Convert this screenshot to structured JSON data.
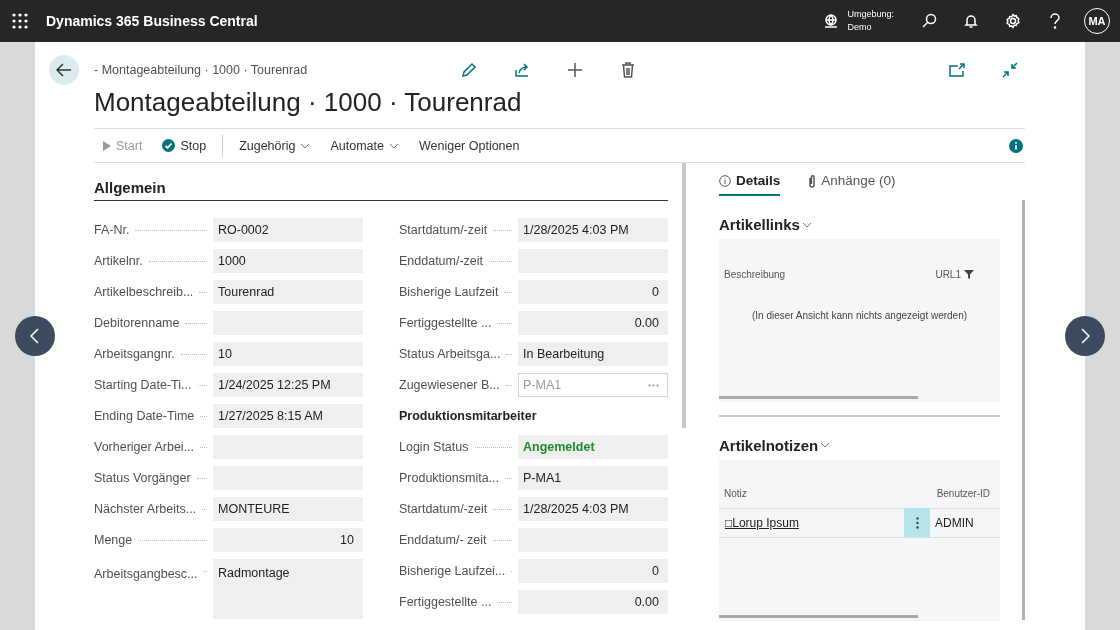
{
  "app_bar": {
    "title": "Dynamics 365 Business Central",
    "environment_label": "Umgebung:",
    "environment_value": "Demo",
    "avatar": "MA"
  },
  "page": {
    "breadcrumb": "- Montageabteilung · 1000 · Tourenrad",
    "title": "Montageabteilung · 1000 · Tourenrad"
  },
  "actions": [
    {
      "label": "Start",
      "kind": "button",
      "disabled": true
    },
    {
      "label": "Stop",
      "kind": "button",
      "disabled": false
    },
    {
      "label": "Zugehörig",
      "kind": "menu",
      "disabled": false
    },
    {
      "label": "Automate",
      "kind": "menu",
      "disabled": false
    },
    {
      "label": "Weniger Optionen",
      "kind": "link",
      "disabled": false
    }
  ],
  "general": {
    "title": "Allgemein",
    "left_fields": [
      {
        "label": "FA-Nr.",
        "value": "RO-0002",
        "kind": "text"
      },
      {
        "label": "Artikelnr.",
        "value": "1000",
        "kind": "text"
      },
      {
        "label": "Artikelbeschreib...",
        "value": "Tourenrad",
        "kind": "text"
      },
      {
        "label": "Debitorenname",
        "kind": "text"
      },
      {
        "label": "Arbeitsgangnr.",
        "value": "10",
        "kind": "text"
      },
      {
        "label": "Starting Date-Ti...",
        "value": "1/24/2025 12:25 PM",
        "kind": "text"
      },
      {
        "label": "Ending Date-Time",
        "value": "1/27/2025 8:15 AM",
        "kind": "text"
      },
      {
        "label": "Vorheriger Arbei...",
        "kind": "text"
      },
      {
        "label": "Status Vorgänger",
        "kind": "text"
      },
      {
        "label": "Nächster Arbeits...",
        "value": "MONTEURE",
        "kind": "text"
      },
      {
        "label": "Menge",
        "value": "10",
        "kind": "number"
      },
      {
        "label": "Arbeitsgangbesc...",
        "value": "Radmontage",
        "kind": "multiline"
      }
    ],
    "right_fields": [
      {
        "label": "Startdatum/-zeit",
        "value": "1/28/2025 4:03 PM",
        "kind": "text"
      },
      {
        "label": "Enddatum/-zeit",
        "kind": "text"
      },
      {
        "label": "Bisherige Laufzeit",
        "value": "0",
        "kind": "number"
      },
      {
        "label": "Fertiggestellte ...",
        "value": "0.00",
        "kind": "number"
      },
      {
        "label": "Status Arbeitsga...",
        "value": "In Bearbeitung",
        "kind": "text"
      },
      {
        "label": "Zugewiesener B...",
        "value": "P-MA1",
        "kind": "lookup"
      },
      {
        "label": "Produktionsmitarbeiter",
        "kind": "heading"
      },
      {
        "label": "Login Status",
        "value": "Angemeldet",
        "kind": "status"
      },
      {
        "label": "Produktionsmita...",
        "value": "P-MA1",
        "kind": "text"
      },
      {
        "label": "Startdatum/-zeit",
        "value": "1/28/2025 4:03 PM",
        "kind": "text"
      },
      {
        "label": "Enddatum/- zeit",
        "kind": "text"
      },
      {
        "label": "Bisherige Laufzei...",
        "value": "0",
        "kind": "number"
      },
      {
        "label": "Fertiggestellte ...",
        "value": "0.00",
        "kind": "number"
      }
    ]
  },
  "factbox": {
    "tabs": [
      {
        "label": "Details",
        "selected": true
      },
      {
        "label": "Anhänge (0)",
        "selected": false
      }
    ],
    "links": {
      "title": "Artikellinks",
      "columns": [
        "Beschreibung",
        "URL1"
      ],
      "empty_message": "(In dieser Ansicht kann nichts angezeigt werden)"
    },
    "notes": {
      "title": "Artikelnotizen",
      "columns": [
        "Notiz",
        "Benutzer-ID"
      ],
      "rows": [
        {
          "note": "□Lorup Ipsum",
          "user": "ADMIN"
        }
      ]
    }
  }
}
